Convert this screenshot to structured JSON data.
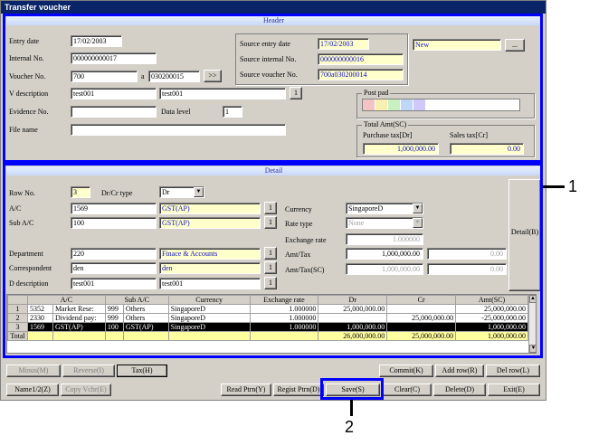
{
  "window": {
    "title": "Transfer voucher"
  },
  "header": {
    "section_label": "Header",
    "entry_date_label": "Entry date",
    "entry_date": "17/02/2003",
    "internal_no_label": "Internal No.",
    "internal_no": "000000000017",
    "voucher_no_label": "Voucher No.",
    "voucher_no": "700",
    "voucher_sep": "a",
    "voucher_no2": "030200015",
    "voucher_btn": ">>",
    "vdesc_label": "V description",
    "vdesc1": "test001",
    "vdesc2": "test001",
    "vdesc_btn": "1",
    "evidence_label": "Evidence No.",
    "evidence": "",
    "data_level_label": "Data level",
    "data_level": "1",
    "file_name_label": "File name",
    "file_name": "",
    "source_entry_date_label": "Source entry date",
    "source_entry_date": "17/02/2003",
    "source_internal_label": "Source internal No.",
    "source_internal": "000000000016",
    "source_voucher_label": "Source voucher No.",
    "source_voucher": "700a030200014",
    "status": "New",
    "status_btn": "...",
    "post_pad_label": "Post pad",
    "total_amt_label": "Total Amt(SC)",
    "purchase_tax_label": "Purchase tax[Dr]",
    "purchase_tax": "1,000,000.00",
    "sales_tax_label": "Sales tax[Cr]",
    "sales_tax": "0.00",
    "post_colors": [
      "#f4c4c4",
      "#f8f0b0",
      "#c8f0c0",
      "#c0d8f8",
      "#d0c8f8"
    ]
  },
  "detail": {
    "section_label": "Detail",
    "row_no_label": "Row No.",
    "row_no": "3",
    "drcr_label": "Dr/Cr type",
    "drcr": "Dr",
    "ac_label": "A/C",
    "ac": "1569",
    "ac_name": "GST(AP)",
    "ac_btn": "1",
    "subac_label": "Sub A/C",
    "subac": "100",
    "subac_name": "GST(AP)",
    "subac_btn": "1",
    "dept_label": "Department",
    "dept": "220",
    "dept_name": "Finace & Accounts",
    "dept_btn": "1",
    "corr_label": "Correspondent",
    "corr": "den",
    "corr_name": "den",
    "corr_btn": "1",
    "ddesc_label": "D description",
    "ddesc1": "test001",
    "ddesc2": "test001",
    "ddesc_btn": "1",
    "currency_label": "Currency",
    "currency": "SingaporeD",
    "rate_type_label": "Rate type",
    "rate_type": "None",
    "exch_rate_label": "Exchange rate",
    "exch_rate": "1.000000",
    "amt_tax_label": "Amt/Tax",
    "amt": "1,000,000.00",
    "tax": "0.00",
    "amt_tax_sc_label": "Amt/Tax(SC)",
    "amt_sc": "1,000,000.00",
    "tax_sc": "0.00",
    "side_btn": "Detail(B)"
  },
  "grid": {
    "columns": [
      "",
      "A/C",
      "",
      "Sub A/C",
      "",
      "Currency",
      "Exchange rate",
      "Dr",
      "Cr",
      "Amt(SC)"
    ],
    "rows": [
      {
        "no": "1",
        "ac": "5352",
        "ac_name": "Market Rese:",
        "sub": "999",
        "sub_name": "Others",
        "currency": "SingaporeD",
        "rate": "1.000000",
        "dr": "25,000,000.00",
        "cr": "",
        "amt": "25,000,000.00"
      },
      {
        "no": "2",
        "ac": "2330",
        "ac_name": "Dividend pay:",
        "sub": "999",
        "sub_name": "Others",
        "currency": "SingaporeD",
        "rate": "1.000000",
        "dr": "",
        "cr": "25,000,000.00",
        "amt": "-25,000,000.00"
      },
      {
        "no": "3",
        "ac": "1569",
        "ac_name": "GST(AP)",
        "sub": "100",
        "sub_name": "GST(AP)",
        "currency": "SingaporeD",
        "rate": "1.000000",
        "dr": "1,000,000.00",
        "cr": "",
        "amt": "1,000,000.00"
      }
    ],
    "total_label": "Total",
    "total_dr": "26,000,000.00",
    "total_cr": "25,000,000.00",
    "total_amt": "1,000,000.00"
  },
  "buttons": {
    "minus": "Minus(M)",
    "reverse": "Reverse(I)",
    "tax": "Tax(H)",
    "commit": "Commit(K)",
    "add_row": "Add row(R)",
    "del_row": "Del row(L)",
    "name12": "Name1/2(Z)",
    "copy_vchr": "Copy Vchr(E)",
    "read_ptrn": "Read Ptrn(Y)",
    "regist_ptrn": "Regist Ptrn(D)",
    "save": "Save(S)",
    "clear": "Clear(C)",
    "delete": "Delete(D)",
    "exit": "Exit(E)"
  },
  "callouts": {
    "one": "1",
    "two": "2"
  },
  "colors": {
    "highlight": "#0000ff",
    "titlebar": "#0a246a",
    "input_yellow": "#ffffcc"
  }
}
